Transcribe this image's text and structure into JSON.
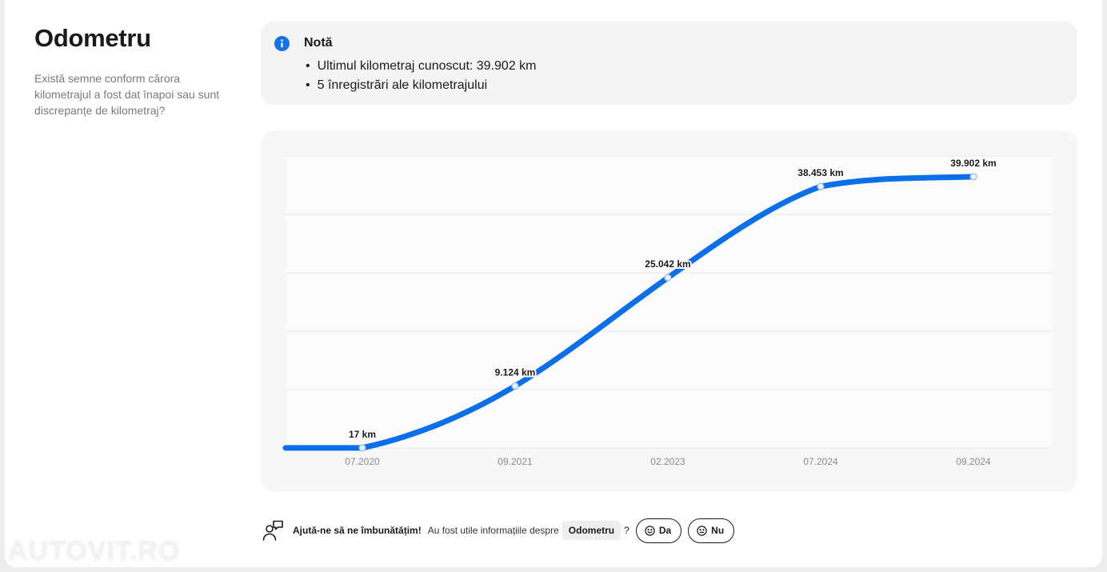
{
  "section": {
    "title": "Odometru",
    "description": "Există semne conform cărora kilometrajul a fost dat înapoi sau sunt discrepanțe de kilometraj?"
  },
  "note": {
    "icon": "info-icon",
    "title": "Notă",
    "items": [
      "Ultimul kilometraj cunoscut: 39.902 km",
      "5 înregistrări ale kilometrajului"
    ]
  },
  "chart_data": {
    "type": "line",
    "categories": [
      "07.2020",
      "09.2021",
      "02.2023",
      "07.2024",
      "09.2024"
    ],
    "values": [
      17,
      9124,
      25042,
      38453,
      39902
    ],
    "data_labels": [
      "17 km",
      "9.124 km",
      "25.042 km",
      "38.453 km",
      "39.902 km"
    ],
    "ylim": [
      0,
      42000
    ],
    "grid": true,
    "line_color": "#0a6fe8",
    "title": "",
    "xlabel": "",
    "ylabel": ""
  },
  "feedback": {
    "icon": "feedback-chat-icon",
    "prompt_strong": "Ajută-ne să ne îmbunătățim!",
    "prompt_text": "Au fost utile informațiile despre",
    "topic": "Odometru",
    "question_mark": "?",
    "yes_label": "Da",
    "no_label": "Nu",
    "yes_icon": "smile-icon",
    "no_icon": "neutral-face-icon"
  },
  "watermark": "AUTOVIT.RO",
  "colors": {
    "accent": "#1473e6",
    "chart_line": "#0a6fe8"
  }
}
